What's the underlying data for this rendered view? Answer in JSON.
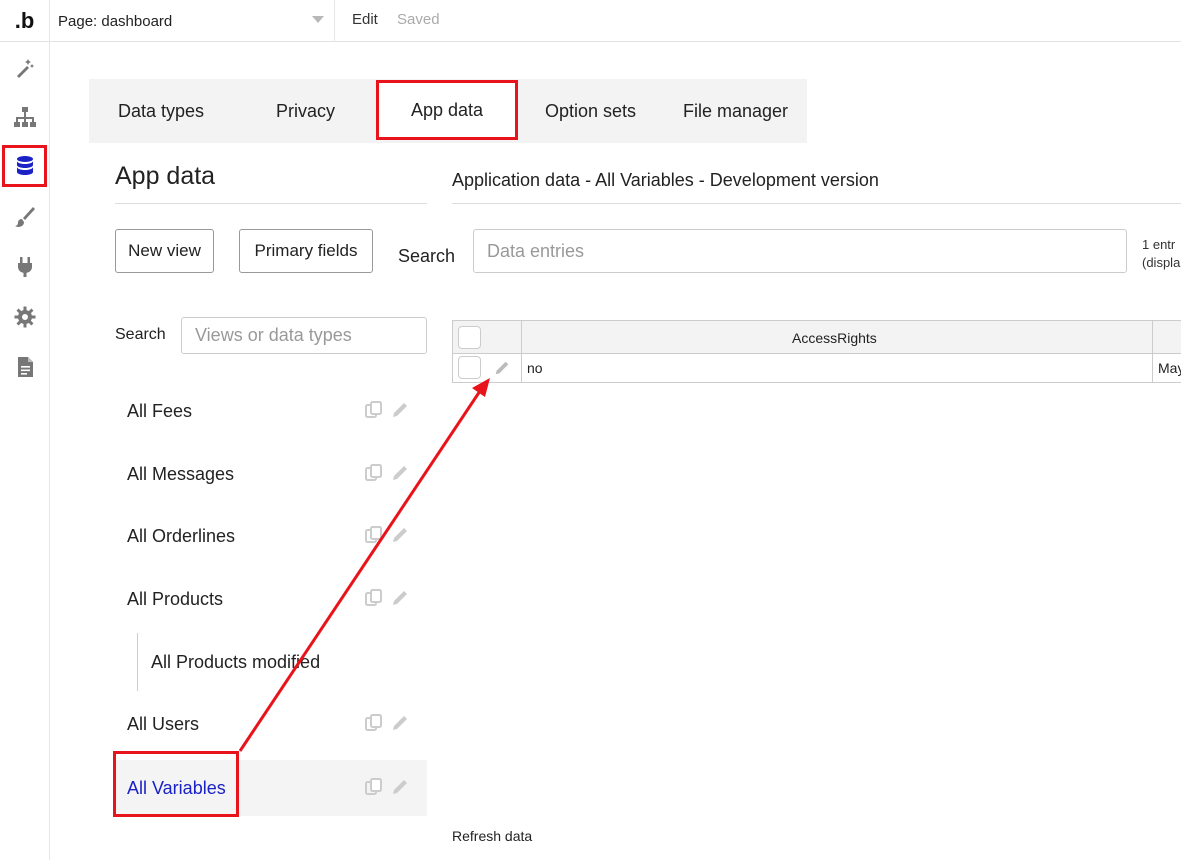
{
  "topbar": {
    "logo": ".b",
    "page_label": "Page: dashboard",
    "edit_label": "Edit",
    "saved_label": "Saved"
  },
  "rail": {
    "icons": [
      "design-icon",
      "sitemap-icon",
      "database-icon",
      "brush-icon",
      "plugin-icon",
      "settings-icon",
      "document-icon"
    ],
    "active": "database-icon"
  },
  "tabs": [
    {
      "label": "Data types"
    },
    {
      "label": "Privacy"
    },
    {
      "label": "App data",
      "active": true
    },
    {
      "label": "Option sets"
    },
    {
      "label": "File manager"
    }
  ],
  "left_panel": {
    "title": "App data",
    "new_view_label": "New view",
    "primary_fields_label": "Primary fields",
    "search_label": "Search",
    "search_placeholder": "Views or data types",
    "items": [
      {
        "label": "All Fees"
      },
      {
        "label": "All Messages"
      },
      {
        "label": "All Orderlines"
      },
      {
        "label": "All Products"
      },
      {
        "label": "All Products modified",
        "sub": true
      },
      {
        "label": "All Users"
      },
      {
        "label": "All Variables",
        "selected": true
      }
    ]
  },
  "main": {
    "title": "Application data - All Variables - Development version",
    "search_label": "Search",
    "search_placeholder": "Data entries",
    "count_line1": "1 entr",
    "count_line2": "(displa",
    "table": {
      "columns": [
        "AccessRights"
      ],
      "rows": [
        {
          "access_rights": "no",
          "next_col": "May"
        }
      ]
    },
    "refresh_label": "Refresh data"
  },
  "colors": {
    "highlight": "#e8131b",
    "selected_text": "#1a21c5",
    "db_icon": "#1a21c5"
  }
}
